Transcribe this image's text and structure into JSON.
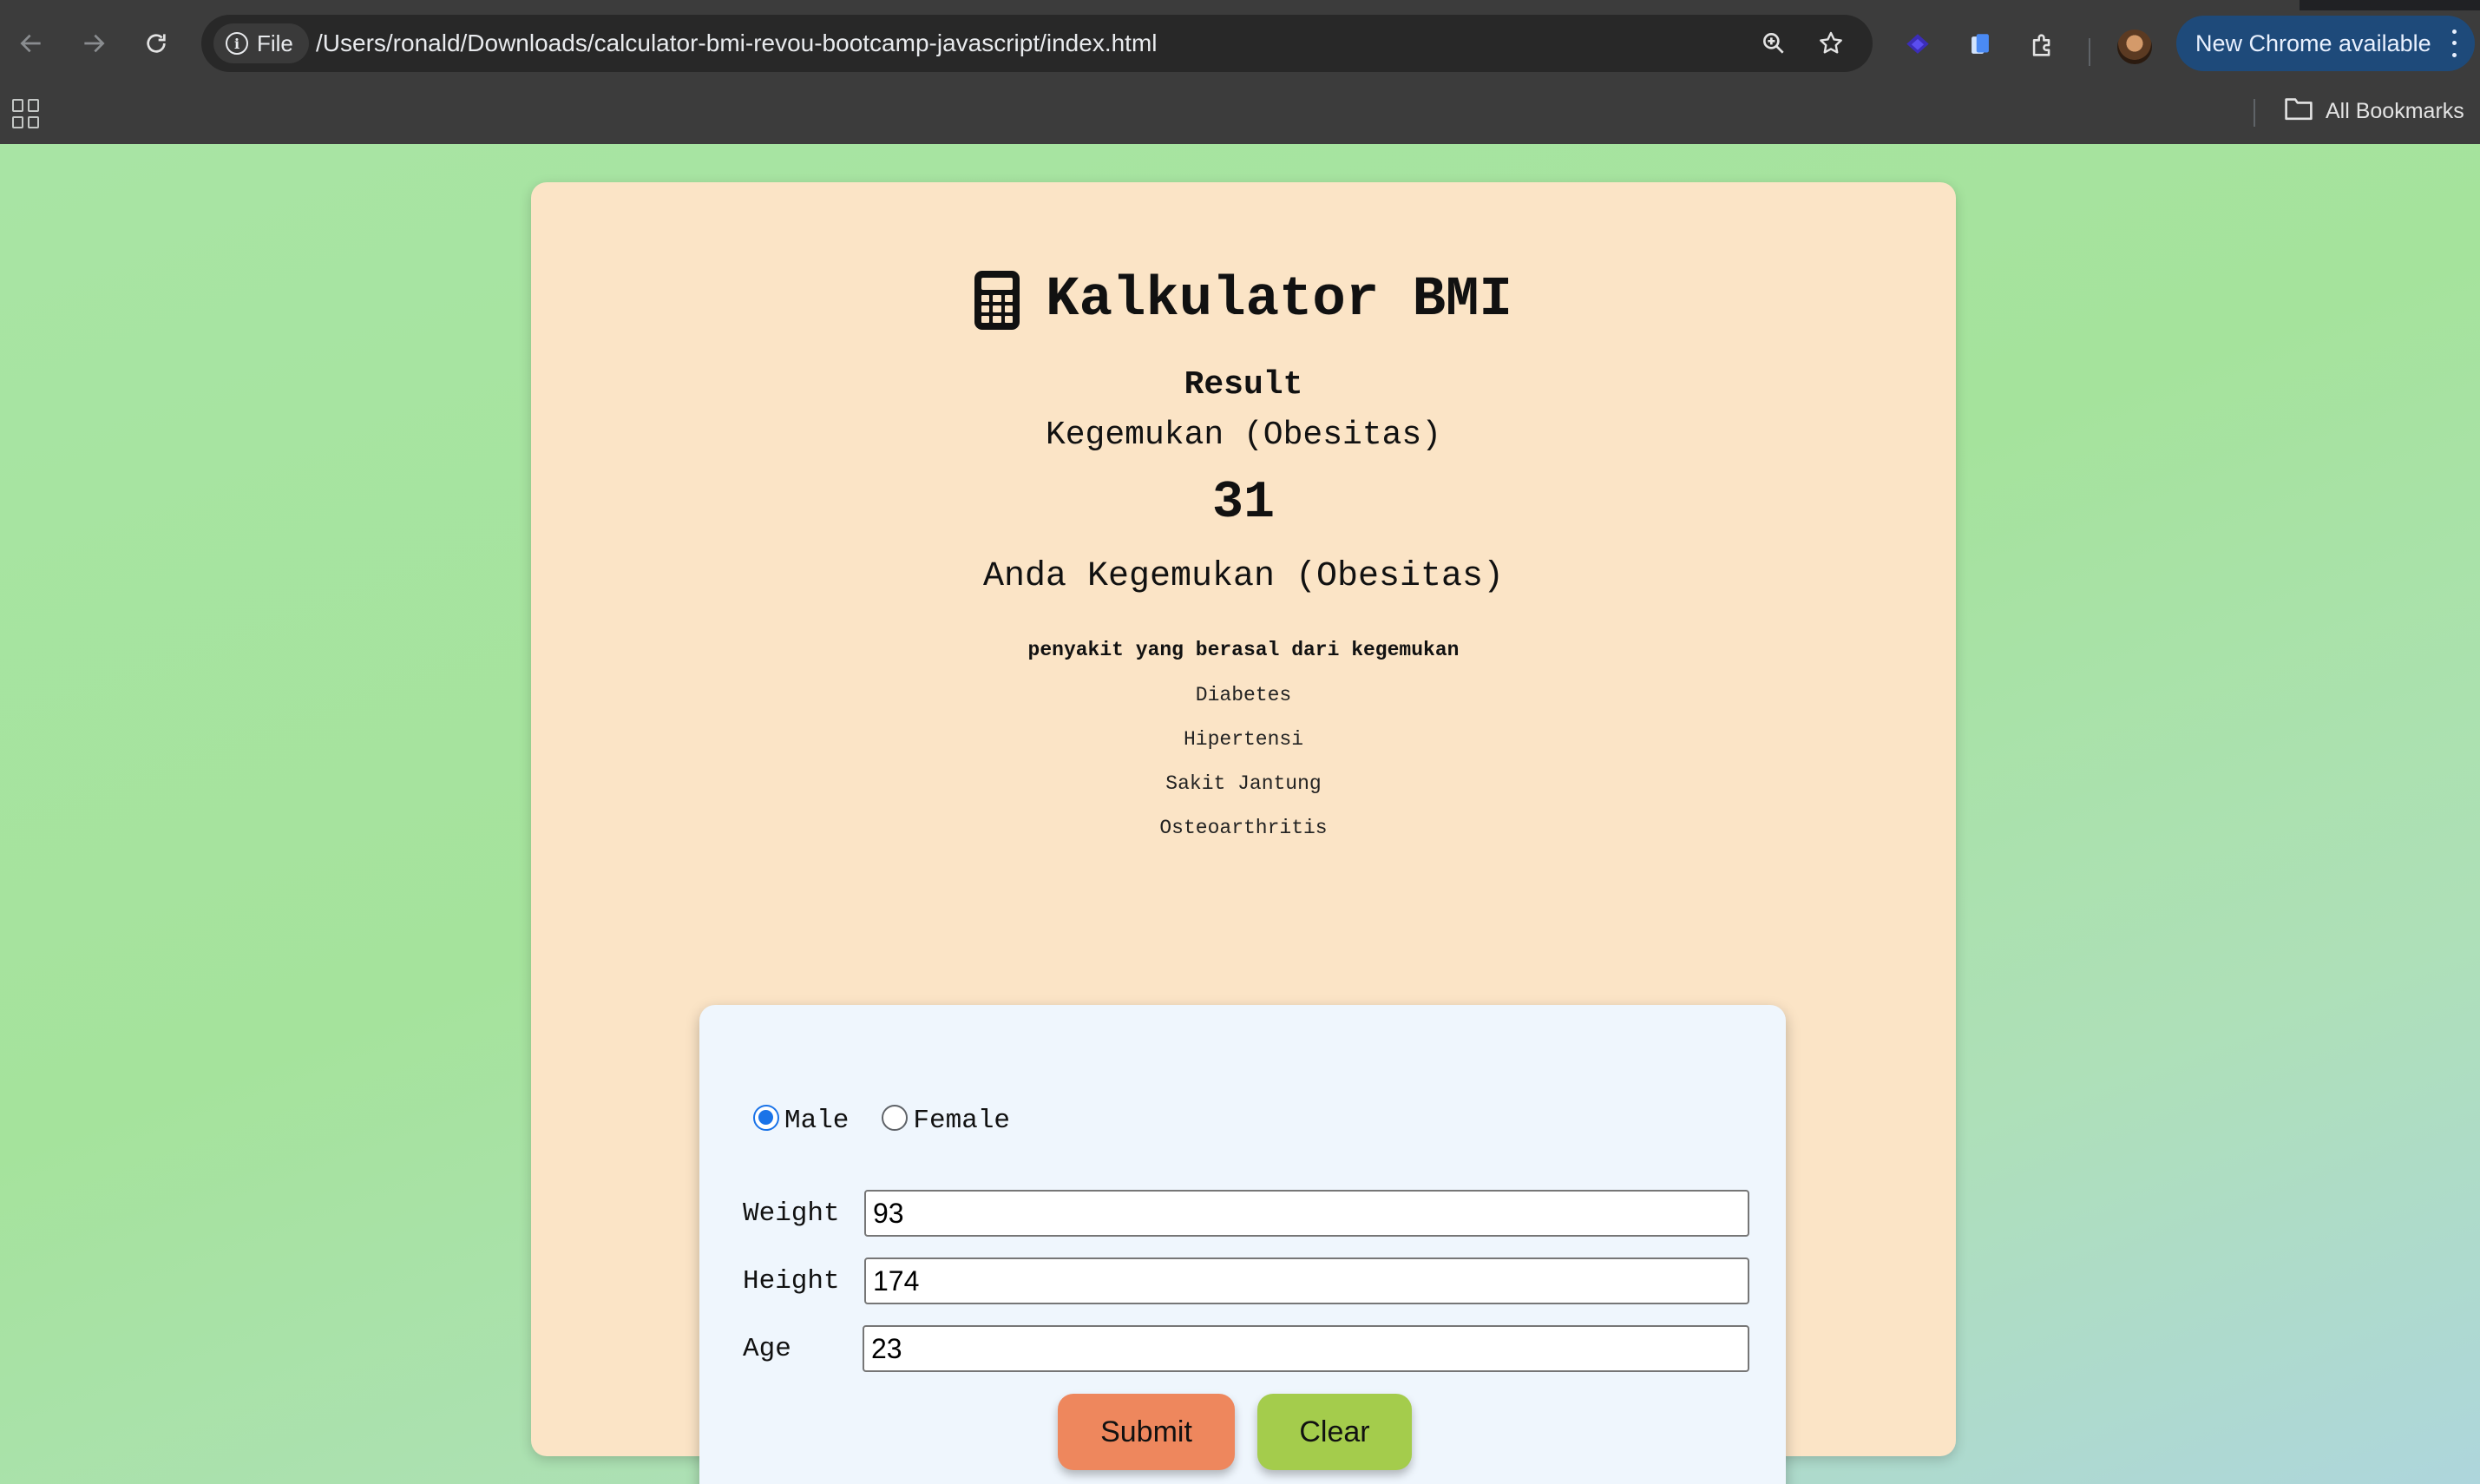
{
  "browser": {
    "site_chip_label": "File",
    "url": "/Users/ronald/Downloads/calculator-bmi-revou-bootcamp-javascript/index.html",
    "update_label": "New Chrome available",
    "all_bookmarks_label": "All Bookmarks",
    "icons": [
      "back-icon",
      "forward-icon",
      "reload-icon",
      "info-icon",
      "zoom-icon",
      "star-icon",
      "extension-purple-icon",
      "extension-doc-icon",
      "extensions-puzzle-icon",
      "avatar",
      "menu-dots-icon",
      "apps-grid-icon",
      "folder-icon"
    ]
  },
  "page": {
    "title": "Kalkulator BMI",
    "title_icon": "calculator-icon",
    "result_label": "Result",
    "category": "Kegemukan (Obesitas)",
    "bmi_value": "31",
    "message": "Anda Kegemukan (Obesitas)",
    "disease_heading": "penyakit yang berasal dari kegemukan",
    "diseases": [
      "Diabetes",
      "Hipertensi",
      "Sakit Jantung",
      "Osteoarthritis"
    ]
  },
  "form": {
    "gender_options": [
      {
        "label": "Male",
        "checked": true
      },
      {
        "label": "Female",
        "checked": false
      }
    ],
    "weight": {
      "label": "Weight",
      "value": "93"
    },
    "height": {
      "label": "Height",
      "value": "174"
    },
    "age": {
      "label": "Age",
      "value": "23"
    },
    "submit_label": "Submit",
    "clear_label": "Clear"
  },
  "colors": {
    "card": "#fbe4c6",
    "form_panel": "#eff6fd",
    "submit": "#ee875d",
    "clear": "#a4cc4c",
    "radio_accent": "#1a73e8"
  }
}
